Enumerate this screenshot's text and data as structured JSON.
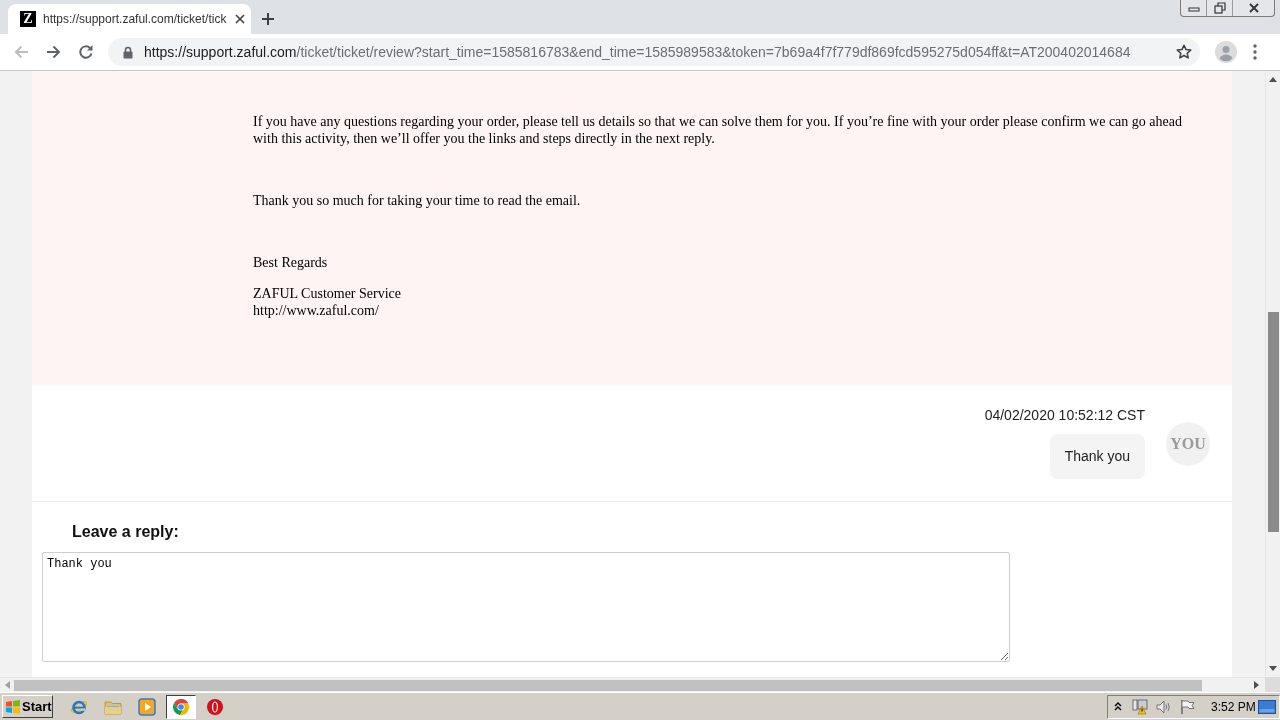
{
  "browser": {
    "tabs": [
      {
        "favicon": "Z",
        "title": "https://support.zaful.com/ticket/tick",
        "selected": true
      }
    ],
    "back_button": {
      "disabled": true
    },
    "forward_button": {
      "disabled": false
    },
    "address_bar": {
      "host": "https://support.zaful.com",
      "path": "/ticket/ticket/review?start_time=1585816783&end_time=1585989583&token=7b69a4f7f779df869fcd595275d054ff&t=AT200402014684"
    }
  },
  "staff_message": {
    "blocks": [
      {
        "kind": "paragraph",
        "text": "If you have any questions regarding your order, please tell us details so that we can solve them for you. If you’re fine with your order please confirm we can go ahead with this activity, then we’ll offer you the links and steps directly in the next reply."
      },
      {
        "kind": "paragraph",
        "text": "Thank you so much for taking your time to read the email."
      },
      {
        "kind": "closing",
        "text": "Best Regards"
      },
      {
        "kind": "signature",
        "lines": [
          "ZAFUL Customer Service",
          "http://www.zaful.com/"
        ]
      }
    ]
  },
  "reply_message": {
    "timestamp": "04/02/2020 10:52:12 CST",
    "text": "Thank you",
    "avatar": "YOU"
  },
  "reply_form": {
    "heading": "Leave a reply:",
    "value": "Thank you"
  },
  "taskbar": {
    "start": "Start",
    "apps": [
      {
        "kind": "ie",
        "selected": false
      },
      {
        "kind": "explorer",
        "selected": false
      },
      {
        "kind": "media_player",
        "selected": false
      },
      {
        "kind": "chrome",
        "selected": true
      },
      {
        "kind": "opera",
        "selected": false
      }
    ],
    "clock": "3:52 PM"
  }
}
